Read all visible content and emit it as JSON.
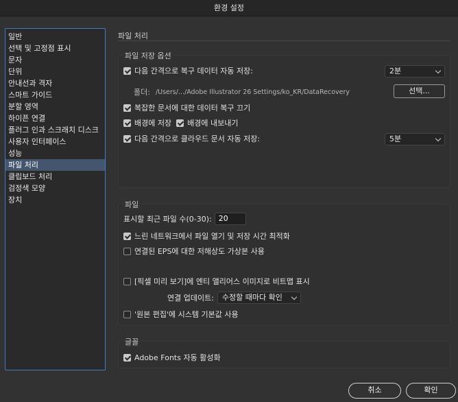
{
  "window": {
    "title": "환경 설정"
  },
  "sidebar": {
    "items": [
      {
        "label": "일반",
        "selected": false
      },
      {
        "label": "선택 및 고정점 표시",
        "selected": false
      },
      {
        "label": "문자",
        "selected": false
      },
      {
        "label": "단위",
        "selected": false
      },
      {
        "label": "안내선과 격자",
        "selected": false
      },
      {
        "label": "스마트 가이드",
        "selected": false
      },
      {
        "label": "분할 영역",
        "selected": false
      },
      {
        "label": "하이픈 연결",
        "selected": false
      },
      {
        "label": "플러그 인과 스크래치 디스크",
        "selected": false
      },
      {
        "label": "사용자 인터페이스",
        "selected": false
      },
      {
        "label": "성능",
        "selected": false
      },
      {
        "label": "파일 처리",
        "selected": true
      },
      {
        "label": "클립보드 처리",
        "selected": false
      },
      {
        "label": "검정색 모양",
        "selected": false
      },
      {
        "label": "장치",
        "selected": false
      }
    ]
  },
  "main": {
    "section_title": "파일 처리",
    "file_save": {
      "label": "파일 저장 옵션",
      "auto_recovery": {
        "label": "다음 간격으로 복구 데이터 자동 저장:",
        "checked": true,
        "interval": "2분"
      },
      "folder_label": "폴더:",
      "folder_path": "/Users/.../Adobe Illustrator 26 Settings/ko_KR/DataRecovery",
      "choose_button": "선택...",
      "disable_complex": {
        "label": "복잡한 문서에 대한 데이터 복구 끄기",
        "checked": true
      },
      "save_background": {
        "label": "배경에 저장",
        "checked": true
      },
      "export_background": {
        "label": "배경에 내보내기",
        "checked": true
      },
      "cloud_auto_save": {
        "label": "다음 간격으로 클라우드 문서 자동 저장:",
        "checked": true,
        "interval": "5분"
      }
    },
    "files": {
      "label": "파일",
      "recent_label": "표시할 최근 파일 수(0-30):",
      "recent_value": "20",
      "optimize_network": {
        "label": "느린 네트워크에서 파일 열기 및 저장 시간 최적화",
        "checked": true
      },
      "low_res_eps": {
        "label": "연결된 EPS에 대한 저해상도 가상본 사용",
        "checked": false
      },
      "pixel_preview_aa": {
        "label": "[픽셀 미리 보기]에 엔티 앨리어스 이미지로 비트맵 표시",
        "checked": false
      },
      "update_links_label": "연결 업데이트:",
      "update_links_value": "수정할 때마다 확인",
      "system_defaults": {
        "label": "'원본 편집'에 시스템 기본값 사용",
        "checked": false
      }
    },
    "fonts": {
      "label": "글꼴",
      "adobe_fonts": {
        "label": "Adobe Fonts 자동 활성화",
        "checked": true
      }
    }
  },
  "footer": {
    "cancel_label": "취소",
    "ok_label": "확인"
  }
}
